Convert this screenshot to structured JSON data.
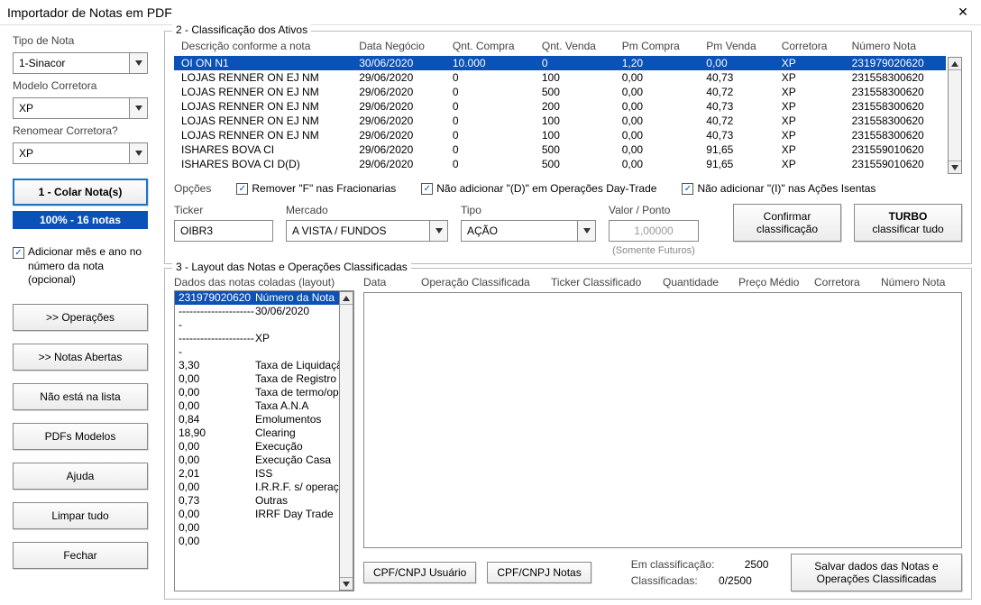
{
  "window": {
    "title": "Importador de Notas em PDF"
  },
  "sidebar": {
    "tipo_lbl": "Tipo de Nota",
    "tipo_val": "1-Sinacor",
    "modelo_lbl": "Modelo Corretora",
    "modelo_val": "XP",
    "renomear_lbl": "Renomear Corretora?",
    "renomear_val": "XP",
    "colar_btn": "1 - Colar Nota(s)",
    "progress": "100%  -  16 notas",
    "add_mes_lbl": "Adicionar mês e ano no número da nota (opcional)",
    "btns": {
      "operacoes": ">> Operações",
      "notas_abertas": ">> Notas Abertas",
      "nao_lista": "Não está na lista",
      "pdfs_modelos": "PDFs Modelos",
      "ajuda": "Ajuda",
      "limpar": "Limpar tudo",
      "fechar": "Fechar"
    }
  },
  "section2": {
    "title": "2 - Classificação dos Ativos",
    "cols": [
      "Descrição conforme a nota",
      "Data Negócio",
      "Qnt. Compra",
      "Qnt. Venda",
      "Pm Compra",
      "Pm Venda",
      "Corretora",
      "Número Nota"
    ],
    "rows": [
      [
        "OI ON N1",
        "30/06/2020",
        "10.000",
        "0",
        "1,20",
        "0,00",
        "XP",
        "231979020620"
      ],
      [
        "LOJAS RENNER ON EJ NM",
        "29/06/2020",
        "0",
        "100",
        "0,00",
        "40,73",
        "XP",
        "231558300620"
      ],
      [
        "LOJAS RENNER ON EJ NM",
        "29/06/2020",
        "0",
        "500",
        "0,00",
        "40,72",
        "XP",
        "231558300620"
      ],
      [
        "LOJAS RENNER ON EJ NM",
        "29/06/2020",
        "0",
        "200",
        "0,00",
        "40,73",
        "XP",
        "231558300620"
      ],
      [
        "LOJAS RENNER ON EJ NM",
        "29/06/2020",
        "0",
        "100",
        "0,00",
        "40,72",
        "XP",
        "231558300620"
      ],
      [
        "LOJAS RENNER ON EJ NM",
        "29/06/2020",
        "0",
        "100",
        "0,00",
        "40,73",
        "XP",
        "231558300620"
      ],
      [
        "ISHARES BOVA CI",
        "29/06/2020",
        "0",
        "500",
        "0,00",
        "91,65",
        "XP",
        "231559010620"
      ],
      [
        "ISHARES BOVA CI D(D)",
        "29/06/2020",
        "0",
        "500",
        "0,00",
        "91,65",
        "XP",
        "231559010620"
      ]
    ],
    "opcoes_lbl": "Opções",
    "opt1": "Remover \"F\" nas Fracionarias",
    "opt2": "Não adicionar \"(D)\" em Operações Day-Trade",
    "opt3": "Não adicionar \"(I)\" nas Ações Isentas",
    "ticker_lbl": "Ticker",
    "ticker_val": "OIBR3",
    "mercado_lbl": "Mercado",
    "mercado_val": "A VISTA / FUNDOS",
    "tipo_lbl": "Tipo",
    "tipo_val": "AÇÃO",
    "valor_lbl": "Valor / Ponto",
    "valor_val": "1,00000",
    "valor_hint": "(Somente Futuros)",
    "confirmar_btn": "Confirmar classificação",
    "turbo_btn": "TURBO classificar tudo"
  },
  "section3": {
    "title": "3 - Layout das Notas e Operações Classificadas",
    "layout_lbl": "Dados das notas coladas (layout)",
    "layout_rows": [
      [
        "231979020620",
        "Número da Nota"
      ],
      [
        "----------------------",
        "30/06/2020"
      ],
      [
        "----------------------",
        "XP"
      ],
      [
        "3,30",
        "Taxa de Liquidaçã"
      ],
      [
        "0,00",
        "Taxa de Registro"
      ],
      [
        "0,00",
        "Taxa de termo/op"
      ],
      [
        "0,00",
        "Taxa A.N.A"
      ],
      [
        "0,84",
        "Emolumentos"
      ],
      [
        "18,90",
        "Clearing"
      ],
      [
        "0,00",
        "Execução"
      ],
      [
        "0,00",
        "Execução Casa"
      ],
      [
        "2,01",
        "ISS"
      ],
      [
        "0,00",
        "I.R.R.F. s/ operaçõ"
      ],
      [
        "0,73",
        "Outras"
      ],
      [
        "0,00",
        "IRRF Day Trade"
      ],
      [
        "0,00",
        ""
      ],
      [
        "0,00",
        ""
      ]
    ],
    "result_cols": [
      "Data",
      "Operação Classificada",
      "Ticker Classificado",
      "Quantidade",
      "Preço Médio",
      "Corretora",
      "Número Nota"
    ],
    "cpf_usuario": "CPF/CNPJ Usuário",
    "cpf_notas": "CPF/CNPJ Notas",
    "em_class_lbl": "Em classificação:",
    "em_class_val": "2500",
    "class_lbl": "Classificadas:",
    "class_val": "0/2500",
    "salvar_btn": "Salvar dados das Notas e Operações Classificadas"
  }
}
